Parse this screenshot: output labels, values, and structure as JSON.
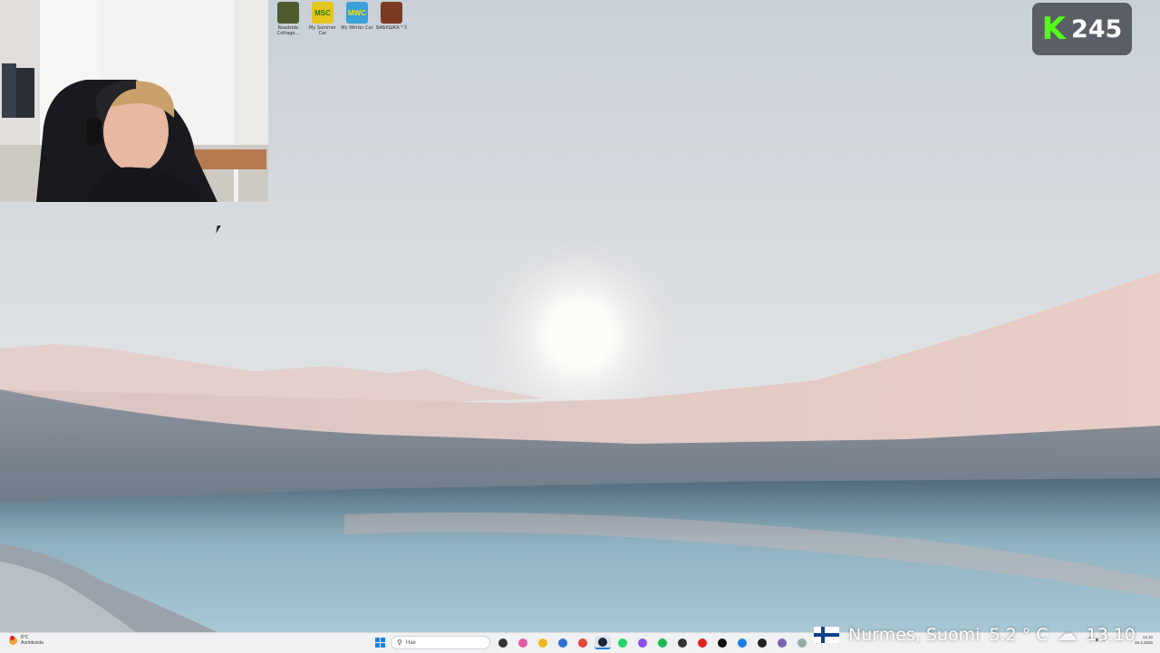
{
  "desktop": {
    "icons": [
      {
        "label": "Roadside Cottage...",
        "color": "#4f5a2e",
        "abbr": ""
      },
      {
        "label": "My Summer Car",
        "color": "#e3c51c",
        "abbr": "MSC"
      },
      {
        "label": "My Winter Car",
        "color": "#3aa0d8",
        "abbr": "MWC"
      },
      {
        "label": "БАБУШКА™3",
        "color": "#7a3b22",
        "abbr": ""
      }
    ]
  },
  "kick_overlay": {
    "logo": "K",
    "count": "245",
    "accent": "#53fc18"
  },
  "stream_info": {
    "location": "Nurmes, Suomi",
    "temperature": "5.2 ° C",
    "time": "13.10",
    "weather_icon": "cloud-icon"
  },
  "taskbar": {
    "weather_temp": "8°C",
    "weather_desc": "Aurinkoista",
    "search_placeholder": "Hae",
    "pinned_apps": [
      {
        "name": "task-view",
        "color": "#333"
      },
      {
        "name": "copilot",
        "color": "#e45aa0"
      },
      {
        "name": "file-explorer",
        "color": "#f3b61f"
      },
      {
        "name": "mail",
        "color": "#2f6fd6"
      },
      {
        "name": "chrome",
        "color": "#e2463a"
      },
      {
        "name": "steam",
        "color": "#1b2838"
      },
      {
        "name": "whatsapp",
        "color": "#25d366"
      },
      {
        "name": "messenger",
        "color": "#8a4ff0"
      },
      {
        "name": "spotify",
        "color": "#1db954"
      },
      {
        "name": "app",
        "color": "#333"
      },
      {
        "name": "app",
        "color": "#d22"
      },
      {
        "name": "app",
        "color": "#111"
      },
      {
        "name": "app",
        "color": "#1a82e2"
      },
      {
        "name": "app",
        "color": "#222"
      },
      {
        "name": "app",
        "color": "#7d5fb0"
      },
      {
        "name": "app",
        "color": "#9aa"
      }
    ],
    "clock_time": "13.10",
    "clock_date": "26.4.2026"
  }
}
